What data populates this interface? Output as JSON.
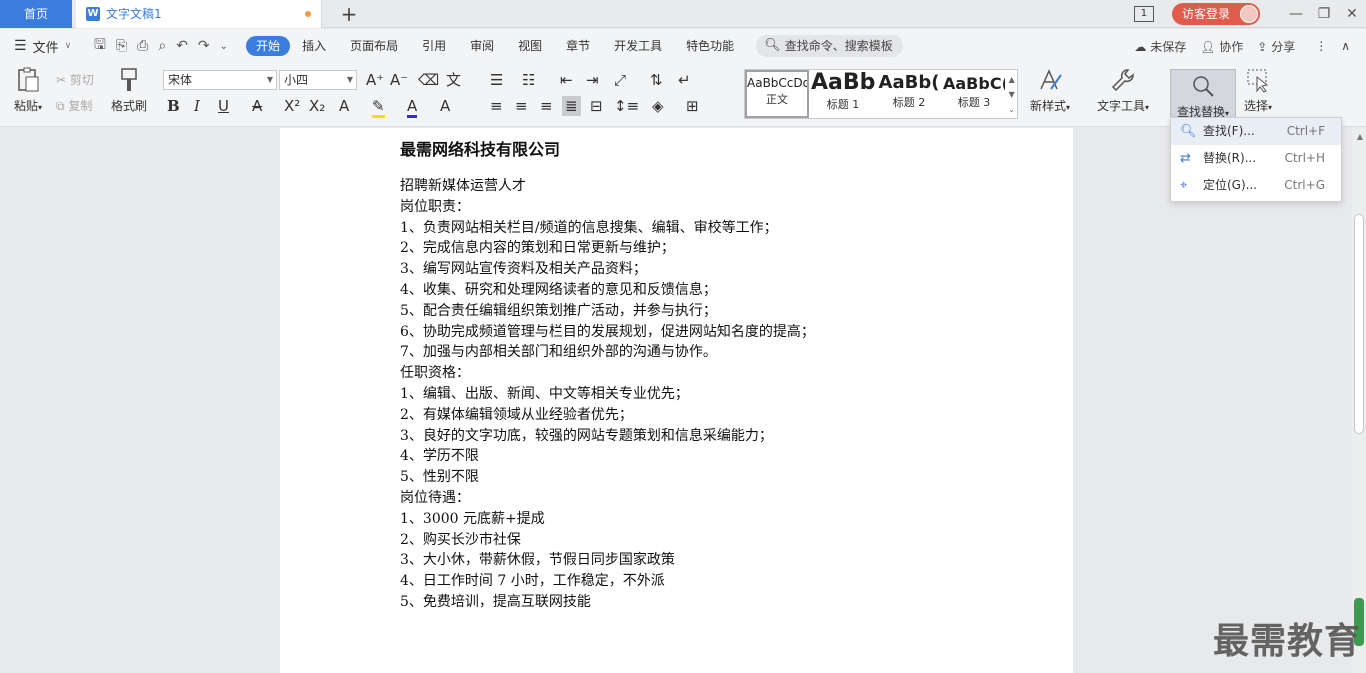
{
  "titlebar": {
    "home_tab": "首页",
    "doc_tab": "文字文稿1",
    "add_tab": "+",
    "login": "访客登录",
    "badge": "1"
  },
  "menubar": {
    "file": "文件",
    "tabs": [
      "开始",
      "插入",
      "页面布局",
      "引用",
      "审阅",
      "视图",
      "章节",
      "开发工具",
      "特色功能"
    ],
    "search": "查找命令、搜索模板",
    "unsaved": "未保存",
    "collab": "协作",
    "share": "分享"
  },
  "ribbon": {
    "paste": "粘贴",
    "cut": "剪切",
    "copy": "复制",
    "format_painter": "格式刷",
    "font_name": "宋体",
    "font_size": "小四",
    "styles": [
      {
        "sample": "AaBbCcDd",
        "label": "正文"
      },
      {
        "sample": "AaBb",
        "label": "标题 1"
      },
      {
        "sample": "AaBb(",
        "label": "标题 2"
      },
      {
        "sample": "AaBbC(",
        "label": "标题 3"
      }
    ],
    "new_style": "新样式",
    "text_tools": "文字工具",
    "find_replace": "查找替换",
    "select": "选择"
  },
  "dropdown": {
    "items": [
      {
        "label": "查找(F)...",
        "shortcut": "Ctrl+F"
      },
      {
        "label": "替换(R)...",
        "shortcut": "Ctrl+H"
      },
      {
        "label": "定位(G)...",
        "shortcut": "Ctrl+G"
      }
    ]
  },
  "document": {
    "title": "最需网络科技有限公司",
    "lines": [
      "招聘新媒体运营人才",
      "岗位职责：",
      "1、负责网站相关栏目/频道的信息搜集、编辑、审校等工作；",
      "2、完成信息内容的策划和日常更新与维护；",
      "3、编写网站宣传资料及相关产品资料；",
      "4、收集、研究和处理网络读者的意见和反馈信息；",
      "5、配合责任编辑组织策划推广活动，并参与执行；",
      "6、协助完成频道管理与栏目的发展规划，促进网站知名度的提高；",
      "7、加强与内部相关部门和组织外部的沟通与协作。",
      "任职资格：",
      "1、编辑、出版、新闻、中文等相关专业优先；",
      "2、有媒体编辑领域从业经验者优先；",
      "3、良好的文字功底，较强的网站专题策划和信息采编能力；",
      "4、学历不限",
      "5、性别不限",
      "岗位待遇：",
      "1、3000 元底薪+提成",
      "2、购买长沙市社保",
      "3、大小休，带薪休假，节假日同步国家政策",
      "4、日工作时间 7 小时，工作稳定，不外派",
      "5、免费培训，提高互联网技能"
    ]
  },
  "watermark": "最需教育"
}
